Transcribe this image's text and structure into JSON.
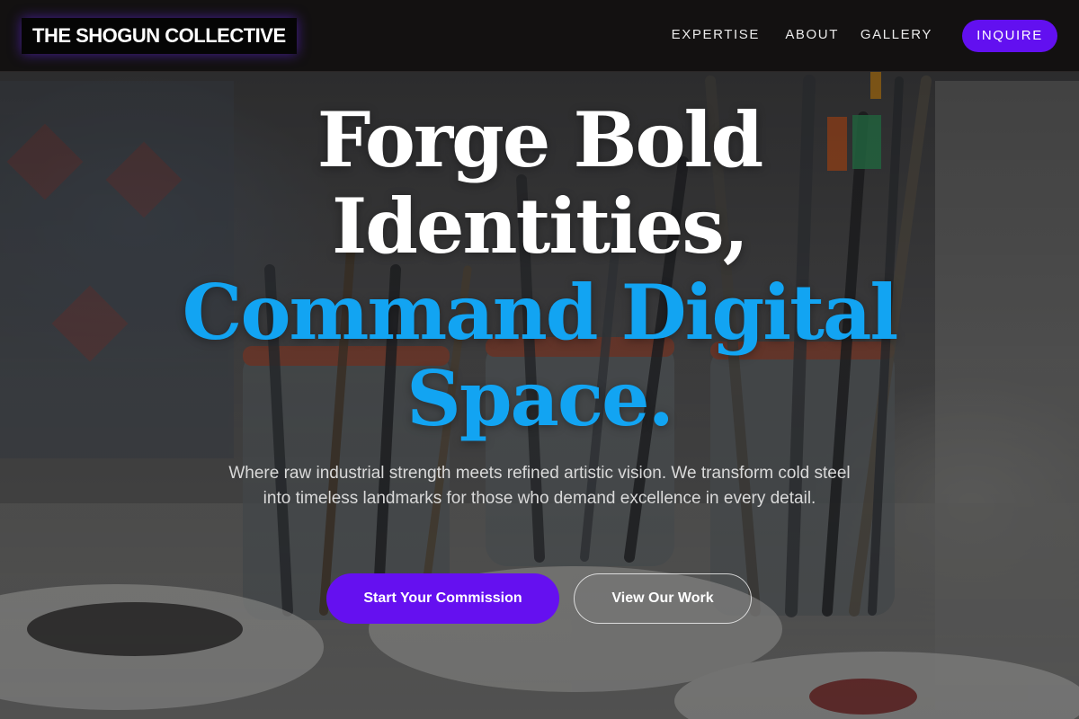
{
  "nav": {
    "logo": "THE SHOGUN COLLECTIVE",
    "links": [
      "EXPERTISE",
      "ABOUT",
      "GALLERY"
    ],
    "cta": "INQUIRE"
  },
  "hero": {
    "title_line1": "Forge Bold",
    "title_line2": "Identities,",
    "title_line3": "Command Digital",
    "title_line4": "Space.",
    "subtitle": "Where raw industrial strength meets refined artistic vision. We transform cold steel into timeless landmarks for those who demand excellence in every detail.",
    "primary_cta": "Start Your Commission",
    "secondary_cta": "View Our Work"
  },
  "colors": {
    "accent_blue": "#12a4f2",
    "brand_purple": "#6210f0",
    "nav_bg": "#131111"
  }
}
